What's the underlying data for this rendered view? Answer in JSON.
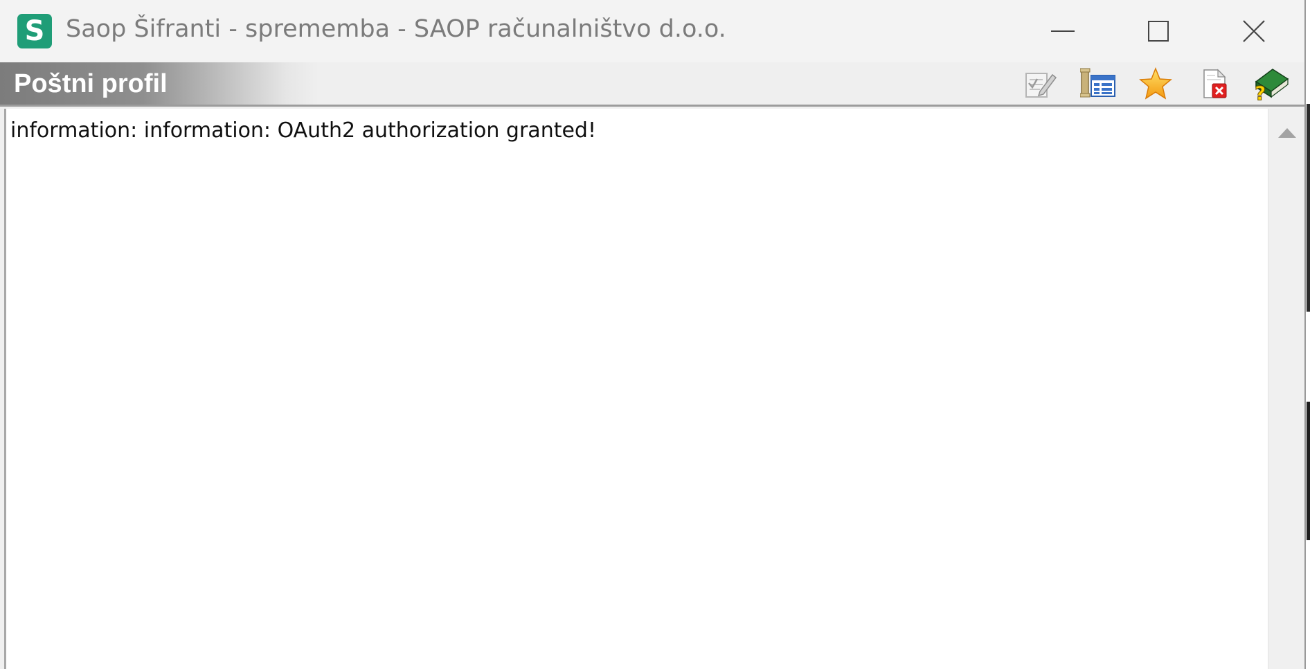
{
  "window": {
    "title": "Saop Šifranti - sprememba - SAOP računalništvo d.o.o.",
    "app_icon_letter": "S",
    "app_icon_color": "#1f9d77",
    "controls": {
      "minimize": "minimize-icon",
      "maximize": "maximize-icon",
      "close": "close-icon"
    }
  },
  "header": {
    "title": "Poštni profil",
    "toolbar": [
      {
        "name": "edit-icon"
      },
      {
        "name": "columns-icon"
      },
      {
        "name": "favorite-star-icon"
      },
      {
        "name": "delete-document-icon"
      },
      {
        "name": "help-book-icon"
      }
    ]
  },
  "content": {
    "message": "information: information: OAuth2 authorization granted!"
  },
  "scrollbar": {
    "up_arrow": "scroll-up-arrow-icon"
  }
}
